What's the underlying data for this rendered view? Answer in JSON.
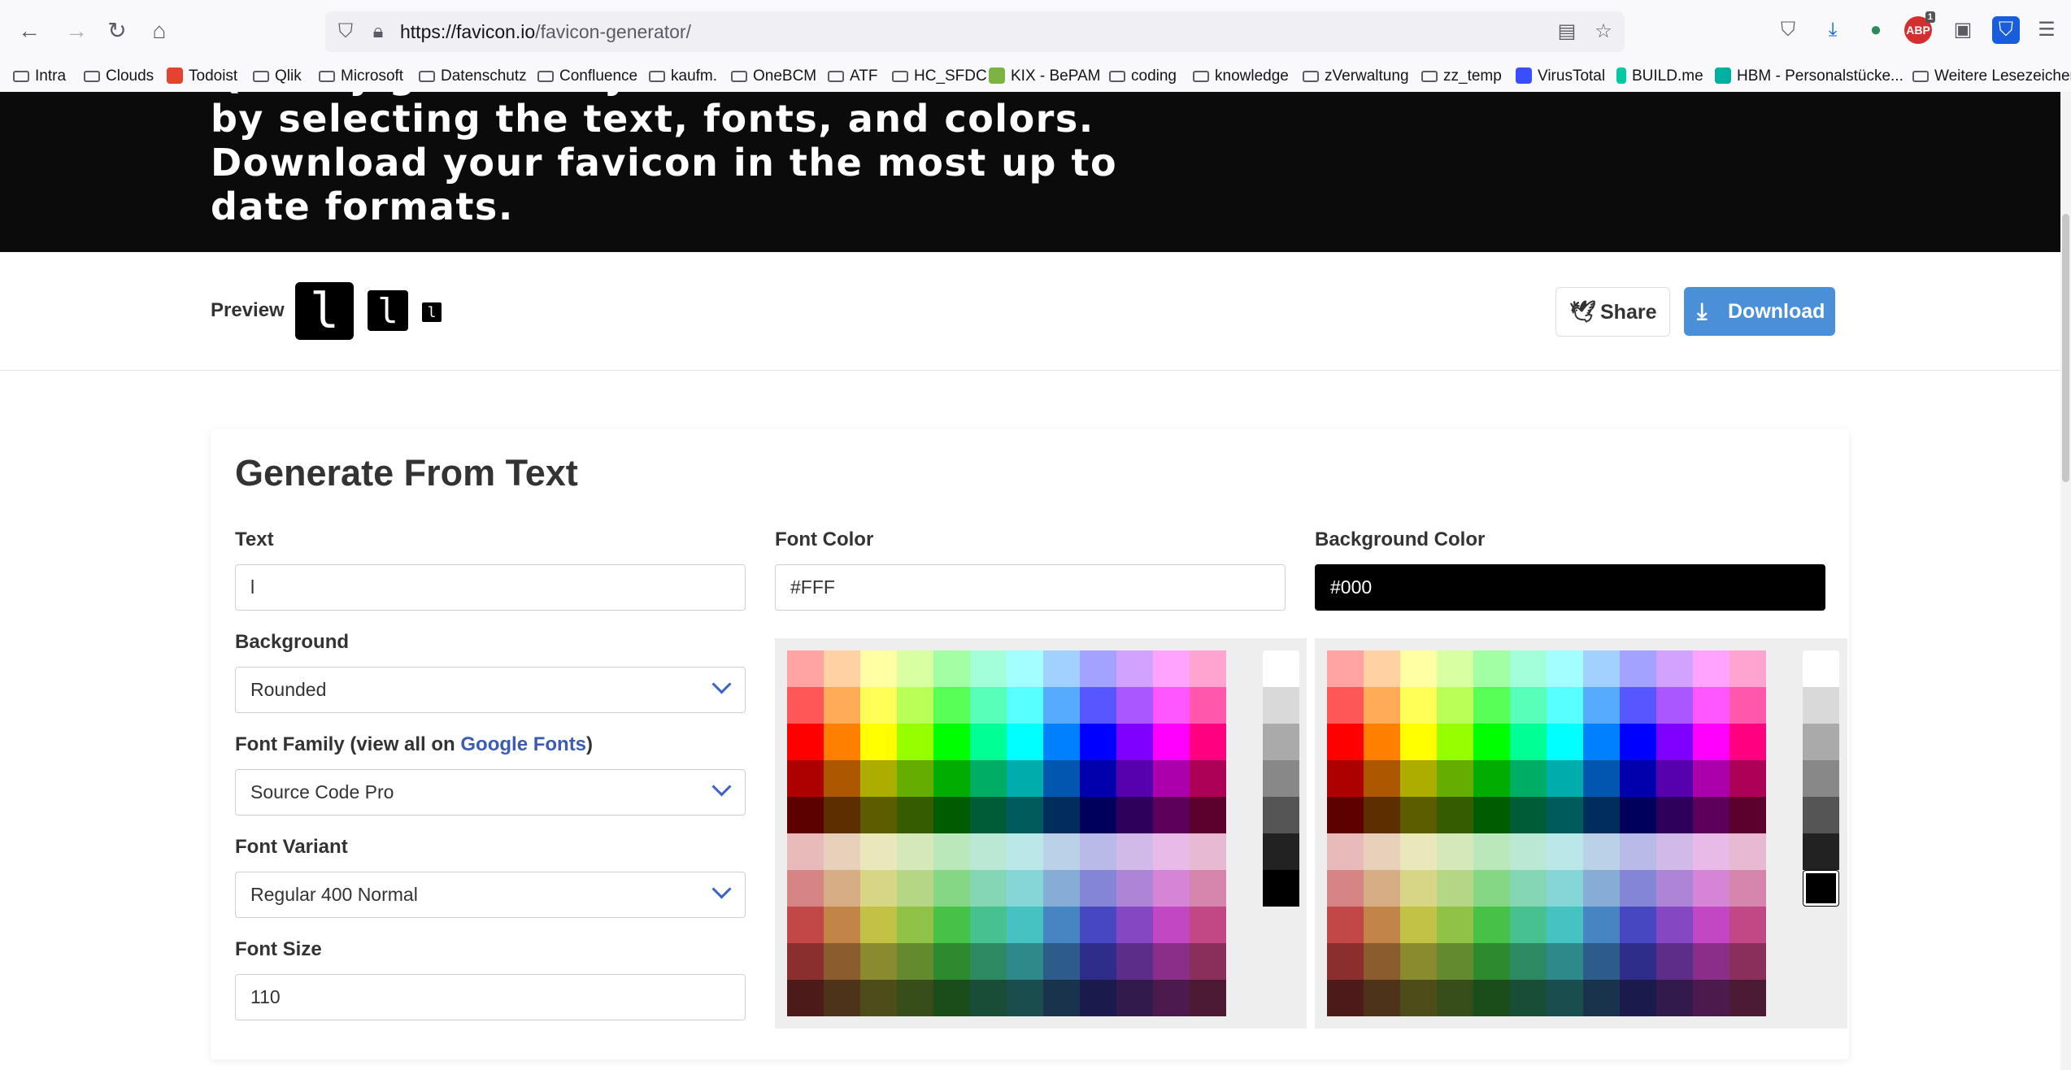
{
  "browser": {
    "url_host": "https://favicon.io",
    "url_path": "/favicon-generator/",
    "bookmarks": [
      "Intra",
      "Clouds",
      "Todoist",
      "Qlik",
      "Microsoft",
      "Datenschutz",
      "Confluence",
      "kaufm.",
      "OneBCM",
      "ATF",
      "HC_SFDC",
      "KIX - BePAM",
      "coding",
      "knowledge",
      "zVerwaltung",
      "zz_temp",
      "VirusTotal",
      "BUILD.me",
      "HBM - Personalstücke...",
      "Weitere Lesezeichen"
    ],
    "abp_badge": "1"
  },
  "hero": {
    "text": "Quickly generate your favicon from text by selecting the text, fonts, and colors. Download your favicon in the most up to date formats."
  },
  "preview": {
    "label": "Preview",
    "glyph": "l",
    "share_label": "Share",
    "download_label": "Download"
  },
  "generator": {
    "title": "Generate From Text",
    "text_label": "Text",
    "text_value": "l",
    "background_label": "Background",
    "background_value": "Rounded",
    "font_family_label_prefix": "Font Family (view all on ",
    "font_family_link": "Google Fonts",
    "font_family_label_suffix": ")",
    "font_family_value": "Source Code Pro",
    "font_variant_label": "Font Variant",
    "font_variant_value": "Regular 400 Normal",
    "font_size_label": "Font Size",
    "font_size_value": "110",
    "font_color_label": "Font Color",
    "font_color_value": "#FFF",
    "bg_color_label": "Background Color",
    "bg_color_value": "#000"
  },
  "palette": {
    "hues": [
      0,
      30,
      60,
      85,
      120,
      155,
      180,
      210,
      240,
      270,
      300,
      330
    ],
    "vivid_lightness": [
      82,
      67,
      50,
      34,
      18
    ],
    "muted_lightness": [
      82,
      68,
      52,
      36,
      20
    ],
    "grays": [
      "#ffffff",
      "#d9d9d9",
      "#aaaaaa",
      "#888888",
      "#555555",
      "#222222",
      "#000000"
    ]
  }
}
